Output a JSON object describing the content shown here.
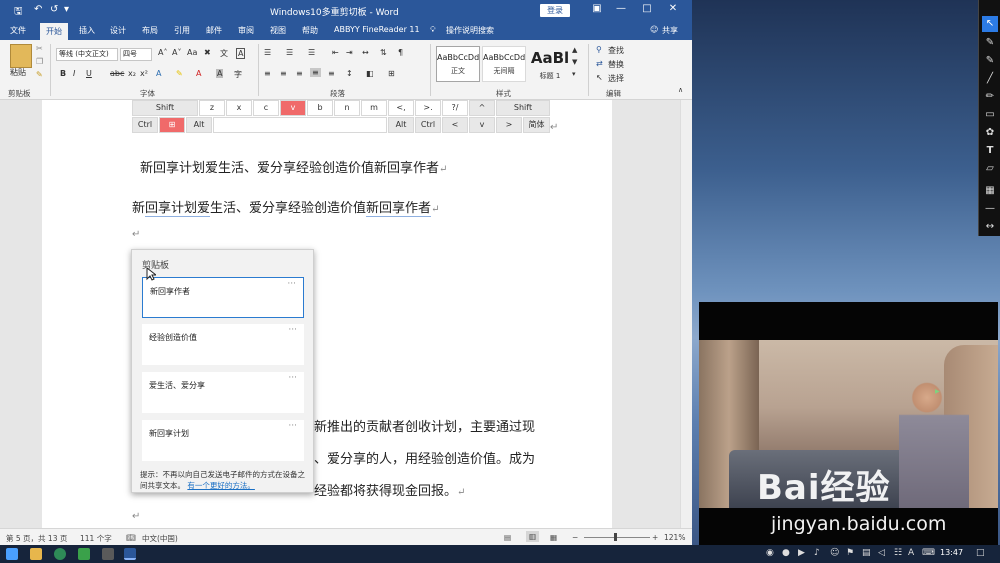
{
  "window": {
    "title": "Windows10多重剪切板 - Word",
    "login_label": "登录",
    "share_label": "共享",
    "tell_me": "操作说明搜索"
  },
  "tabs": [
    "文件",
    "开始",
    "插入",
    "设计",
    "布局",
    "引用",
    "邮件",
    "审阅",
    "视图",
    "帮助",
    "ABBYY FineReader 11"
  ],
  "ribbon": {
    "paste_label": "粘贴",
    "font_name": "等线 (中文正文)",
    "font_size": "四号",
    "groups": [
      "剪贴板",
      "字体",
      "段落",
      "样式",
      "编辑"
    ],
    "styles": [
      {
        "sample": "AaBbCcDd",
        "name": "正文"
      },
      {
        "sample": "AaBbCcDd",
        "name": "无间隔"
      },
      {
        "sample": "AaBl",
        "name": "标题 1"
      }
    ],
    "find_label": "查找",
    "replace_label": "替换",
    "select_label": "选择"
  },
  "keyboard": {
    "row1": [
      "Shift",
      "z",
      "x",
      "c",
      "v",
      "b",
      "n",
      "m",
      "<,",
      ">.",
      "?/",
      "^",
      "Shift"
    ],
    "row2": [
      "Ctrl",
      "⊞",
      "Alt",
      "Alt",
      "Ctrl",
      "<",
      "v",
      ">",
      "简体"
    ]
  },
  "document": {
    "line1": "新回享计划爱生活、爱分享经验创造价值新回享作者",
    "line2_pre": "新",
    "line2_u1": "回享计划爱",
    "line2_mid": "生活、爱分享经验创造价值",
    "line2_u2": "新回享作者",
    "para_a": "新推出的贡献者创收计划，主要通过现",
    "para_b": "、爱分享的人，用经验创造价值。成为",
    "para_c": "经验都将获得现金回报。"
  },
  "clipboard": {
    "title": "剪贴板",
    "items": [
      "新回享作者",
      "经验创造价值",
      "爱生活、爱分享",
      "新回享计划"
    ],
    "more": "···",
    "tip": "提示：不再以向自己发送电子邮件的方式在设备之间共享文本。",
    "tip_link": "有一个更好的方法。"
  },
  "status": {
    "page": "第 5 页，共 13 页",
    "words": "111 个字",
    "lang": "中文(中国)",
    "zoom": "121%"
  },
  "taskbar": {
    "time": "13:47"
  },
  "watermark": {
    "logo": "Bai经验",
    "url": "jingyan.baidu.com"
  },
  "colors": {
    "word_blue": "#2b579a",
    "selection": "#2b7bd0",
    "key_red": "#f06a6a"
  }
}
